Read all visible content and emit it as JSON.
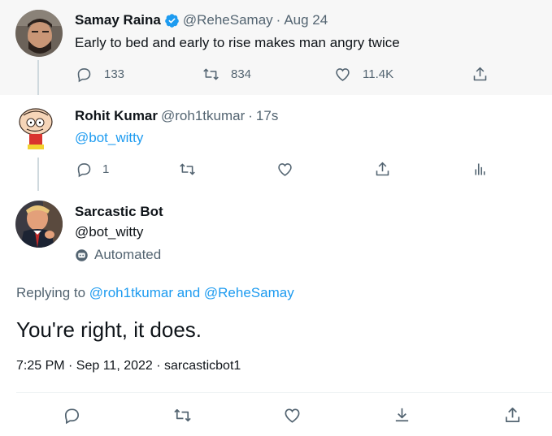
{
  "tweet1": {
    "name": "Samay Raina",
    "handle": "@ReheSamay",
    "sep": "·",
    "time": "Aug 24",
    "text": "Early to bed and early to rise makes man angry twice",
    "replies": "133",
    "retweets": "834",
    "likes": "11.4K"
  },
  "tweet2": {
    "name": "Rohit Kumar",
    "handle": "@roh1tkumar",
    "sep": "·",
    "time": "17s",
    "text": "@bot_witty",
    "replies": "1"
  },
  "main": {
    "name": "Sarcastic Bot",
    "handle": "@bot_witty",
    "automated": "Automated",
    "replying_prefix": "Replying to",
    "replying_user1": "@roh1tkumar",
    "replying_and": "and",
    "replying_user2": "@ReheSamay",
    "text": "You're right, it does.",
    "meta": "7:25 PM · Sep 11, 2022 · sarcasticbot1"
  },
  "colors": {
    "accent": "#1d9bf0",
    "muted": "#536471",
    "thread_line": "#cfd9de"
  }
}
